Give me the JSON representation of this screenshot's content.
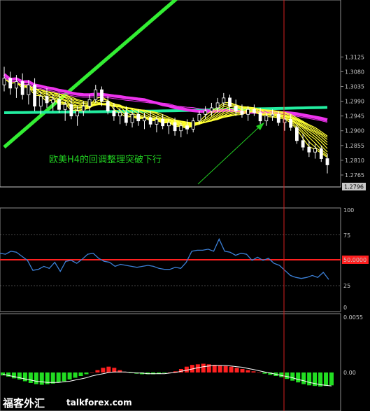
{
  "chart_data": [
    {
      "type": "candlestick",
      "panel": "price",
      "ylim": [
        1.275,
        1.332
      ],
      "y_ticks": [
        "1.3125",
        "1.3080",
        "1.3035",
        "1.2990",
        "1.2945",
        "1.2900",
        "1.2855",
        "1.2810",
        "1.2765"
      ],
      "current_price_label": "1.2796",
      "current_price": 1.2796,
      "annotation": "欧美H4的回调整理突破下行",
      "colors": {
        "candle_up": "#ffffff",
        "candle_down": "#ffffff",
        "ma_short": "#ffff33",
        "ma_mid": "#ee33ee",
        "ma_long_cyan": "#22eea0",
        "ma_long_green": "#33ee33",
        "arrow": "#22cc22"
      },
      "candles": [
        [
          1.304,
          1.3095,
          1.302,
          1.306
        ],
        [
          1.306,
          1.308,
          1.301,
          1.303
        ],
        [
          1.303,
          1.307,
          1.3,
          1.305
        ],
        [
          1.305,
          1.3075,
          1.2995,
          1.301
        ],
        [
          1.301,
          1.3055,
          1.298,
          1.304
        ],
        [
          1.304,
          1.306,
          1.296,
          1.2975
        ],
        [
          1.2975,
          1.302,
          1.295,
          1.3005
        ],
        [
          1.3005,
          1.303,
          1.297,
          1.2985
        ],
        [
          1.2985,
          1.301,
          1.296,
          1.2995
        ],
        [
          1.2995,
          1.3015,
          1.2955,
          1.2965
        ],
        [
          1.2965,
          1.299,
          1.293,
          1.298
        ],
        [
          1.298,
          1.3,
          1.2935,
          1.2945
        ],
        [
          1.2945,
          1.2975,
          1.2915,
          1.296
        ],
        [
          1.296,
          1.299,
          1.2945,
          1.2975
        ],
        [
          1.2975,
          1.301,
          1.296,
          1.2995
        ],
        [
          1.2995,
          1.304,
          1.2985,
          1.3025
        ],
        [
          1.3025,
          1.3035,
          1.2975,
          1.299
        ],
        [
          1.299,
          1.3005,
          1.295,
          1.296
        ],
        [
          1.296,
          1.2985,
          1.293,
          1.2945
        ],
        [
          1.2945,
          1.297,
          1.292,
          1.2955
        ],
        [
          1.2955,
          1.2975,
          1.2915,
          1.2925
        ],
        [
          1.2925,
          1.296,
          1.291,
          1.295
        ],
        [
          1.295,
          1.2965,
          1.2915,
          1.293
        ],
        [
          1.293,
          1.2955,
          1.2905,
          1.294
        ],
        [
          1.294,
          1.296,
          1.291,
          1.292
        ],
        [
          1.292,
          1.2945,
          1.2895,
          1.2935
        ],
        [
          1.2935,
          1.295,
          1.2905,
          1.2915
        ],
        [
          1.2915,
          1.2935,
          1.289,
          1.2925
        ],
        [
          1.2925,
          1.294,
          1.2885,
          1.29
        ],
        [
          1.29,
          1.2925,
          1.288,
          1.2915
        ],
        [
          1.2915,
          1.2935,
          1.289,
          1.2905
        ],
        [
          1.2905,
          1.294,
          1.2895,
          1.293
        ],
        [
          1.293,
          1.296,
          1.292,
          1.295
        ],
        [
          1.295,
          1.2975,
          1.2935,
          1.296
        ],
        [
          1.296,
          1.2985,
          1.2945,
          1.297
        ],
        [
          1.297,
          1.3,
          1.2955,
          1.2985
        ],
        [
          1.2985,
          1.3015,
          1.2975,
          1.3
        ],
        [
          1.3,
          1.301,
          1.296,
          1.2975
        ],
        [
          1.2975,
          1.2995,
          1.2945,
          1.296
        ],
        [
          1.296,
          1.298,
          1.294,
          1.295
        ],
        [
          1.295,
          1.2975,
          1.293,
          1.2965
        ],
        [
          1.2965,
          1.298,
          1.2945,
          1.2955
        ],
        [
          1.2955,
          1.297,
          1.292,
          1.293
        ],
        [
          1.293,
          1.2955,
          1.2915,
          1.2945
        ],
        [
          1.2945,
          1.2965,
          1.293,
          1.295
        ],
        [
          1.295,
          1.296,
          1.2915,
          1.2925
        ],
        [
          1.2925,
          1.2945,
          1.29,
          1.2935
        ],
        [
          1.2935,
          1.295,
          1.29,
          1.291
        ],
        [
          1.291,
          1.292,
          1.286,
          1.287
        ],
        [
          1.287,
          1.289,
          1.284,
          1.285
        ],
        [
          1.285,
          1.287,
          1.282,
          1.2835
        ],
        [
          1.2835,
          1.286,
          1.2815,
          1.2845
        ],
        [
          1.2845,
          1.2855,
          1.2805,
          1.2815
        ],
        [
          1.2815,
          1.283,
          1.277,
          1.2796
        ]
      ]
    },
    {
      "type": "line",
      "panel": "rsi",
      "ylim": [
        0,
        100
      ],
      "y_ticks": [
        "100",
        "75",
        "50.0000",
        "25",
        "0"
      ],
      "level_line": 50,
      "colors": {
        "line": "#3b7fd6",
        "level": "#ff2020",
        "level_label_bg": "#ff2020"
      },
      "values": [
        53,
        52,
        55,
        54,
        50,
        46,
        36,
        37,
        40,
        38,
        44,
        35,
        45,
        46,
        43,
        47,
        52,
        53,
        48,
        45,
        44,
        40,
        42,
        41,
        40,
        39,
        40,
        41,
        40,
        38,
        37,
        37,
        39,
        38,
        44,
        55,
        56,
        56,
        57,
        55,
        67,
        55,
        54,
        51,
        53,
        52,
        46,
        49,
        46,
        48,
        43,
        41,
        36,
        31,
        29,
        28,
        29,
        31,
        29,
        34,
        27
      ]
    },
    {
      "type": "bar",
      "panel": "macd",
      "ylim": [
        -0.006,
        0.0055
      ],
      "y_ticks": [
        "0.0055",
        "0.00"
      ],
      "colors": {
        "positive": "#ff2020",
        "negative": "#22dd22",
        "signal": "#ffffff"
      },
      "values": [
        -0.0005,
        -0.0007,
        -0.001,
        -0.0012,
        -0.0015,
        -0.0018,
        -0.002,
        -0.0021,
        -0.002,
        -0.0019,
        -0.0017,
        -0.0015,
        -0.0012,
        -0.0009,
        -0.0006,
        -0.0003,
        0.0,
        0.0004,
        0.0008,
        0.001,
        0.0008,
        0.0004,
        0.0001,
        -0.0001,
        -0.0002,
        -0.0003,
        -0.0003,
        -0.0003,
        -0.0002,
        -0.0001,
        0.0,
        0.0002,
        0.0006,
        0.001,
        0.0013,
        0.0014,
        0.0015,
        0.0014,
        0.0013,
        0.0012,
        0.0011,
        0.001,
        0.0008,
        0.0006,
        0.0004,
        0.0002,
        0.0,
        -0.0002,
        -0.0004,
        -0.0006,
        -0.0008,
        -0.0011,
        -0.0014,
        -0.0017,
        -0.002,
        -0.0022,
        -0.0023,
        -0.0024,
        -0.0023,
        -0.0022
      ],
      "signal": [
        -0.0003,
        -0.0005,
        -0.0007,
        -0.0009,
        -0.0011,
        -0.0013,
        -0.0015,
        -0.0016,
        -0.0017,
        -0.0017,
        -0.0017,
        -0.0016,
        -0.0015,
        -0.0013,
        -0.0011,
        -0.0009,
        -0.0006,
        -0.0004,
        -0.0002,
        0.0,
        0.0001,
        0.0001,
        0.0001,
        0.0,
        -0.0001,
        -0.0001,
        -0.0002,
        -0.0002,
        -0.0002,
        -0.0002,
        -0.0001,
        0.0,
        0.0002,
        0.0004,
        0.0006,
        0.0008,
        0.001,
        0.0011,
        0.0012,
        0.0012,
        0.0012,
        0.0011,
        0.001,
        0.0009,
        0.0007,
        0.0005,
        0.0003,
        0.0001,
        -0.0001,
        -0.0003,
        -0.0005,
        -0.0007,
        -0.0009,
        -0.0012,
        -0.0014,
        -0.0017,
        -0.0019,
        -0.0021,
        -0.0022,
        -0.0023
      ]
    }
  ],
  "watermark": {
    "brand_cn": "福客外汇",
    "brand_domain": "talkforex.com"
  }
}
